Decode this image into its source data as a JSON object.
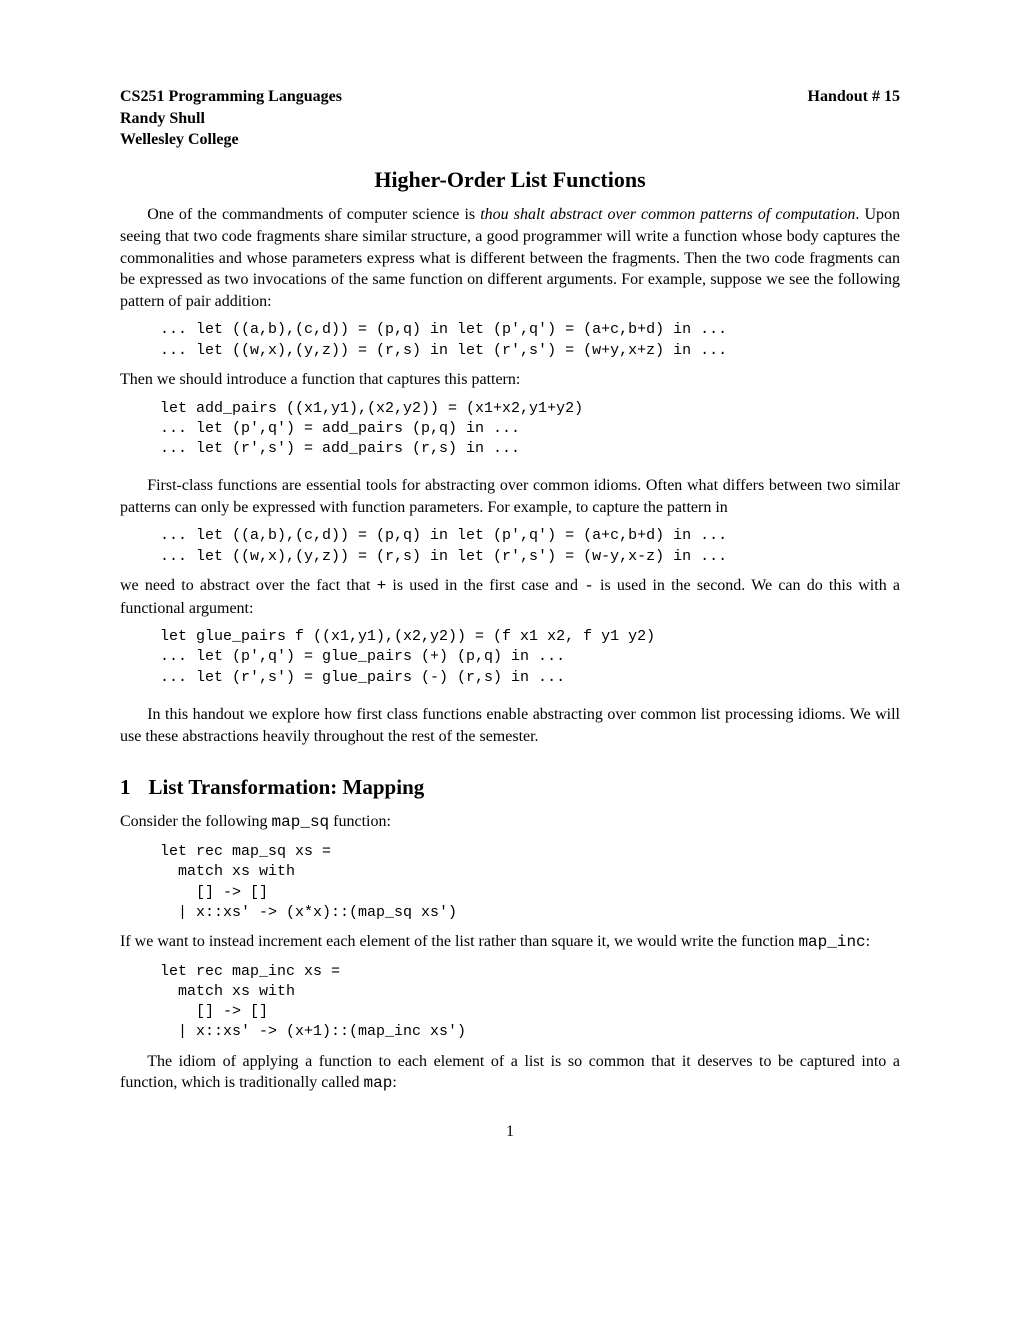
{
  "header": {
    "left_line1": "CS251 Programming Languages",
    "left_line2": "Randy Shull",
    "left_line3": "Wellesley College",
    "right": "Handout # 15"
  },
  "title": "Higher-Order List Functions",
  "para1_lead": "One of the commandments of computer science is ",
  "para1_ital": "thou shalt abstract over common patterns of computation",
  "para1_rest": ". Upon seeing that two code fragments share similar structure, a good programmer will write a function whose body captures the commonalities and whose parameters express what is different between the fragments. Then the two code fragments can be expressed as two invocations of the same function on different arguments. For example, suppose we see the following pattern of pair addition:",
  "code1": "... let ((a,b),(c,d)) = (p,q) in let (p',q') = (a+c,b+d) in ...\n... let ((w,x),(y,z)) = (r,s) in let (r',s') = (w+y,x+z) in ...",
  "para2": "Then we should introduce a function that captures this pattern:",
  "code2": "let add_pairs ((x1,y1),(x2,y2)) = (x1+x2,y1+y2)\n... let (p',q') = add_pairs (p,q) in ...\n... let (r',s') = add_pairs (r,s) in ...",
  "para3": "First-class functions are essential tools for abstracting over common idioms. Often what differs between two similar patterns can only be expressed with function parameters. For example, to capture the pattern in",
  "code3": "... let ((a,b),(c,d)) = (p,q) in let (p',q') = (a+c,b+d) in ...\n... let ((w,x),(y,z)) = (r,s) in let (r',s') = (w-y,x-z) in ...",
  "para4_a": "we need to abstract over the fact that ",
  "para4_plus": "+",
  "para4_b": " is used in the first case and ",
  "para4_minus": "-",
  "para4_c": " is used in the second. We can do this with a functional argument:",
  "code4": "let glue_pairs f ((x1,y1),(x2,y2)) = (f x1 x2, f y1 y2)\n... let (p',q') = glue_pairs (+) (p,q) in ...\n... let (r',s') = glue_pairs (-) (r,s) in ...",
  "para5": "In this handout we explore how first class functions enable abstracting over common list processing idioms. We will use these abstractions heavily throughout the rest of the semester.",
  "sec1_num": "1",
  "sec1_title": "List Transformation: Mapping",
  "para6_a": "Consider the following ",
  "para6_tt": "map_sq",
  "para6_b": " function:",
  "code5": "let rec map_sq xs =\n  match xs with\n    [] -> []\n  | x::xs' -> (x*x)::(map_sq xs')",
  "para7_a": "If we want to instead increment each element of the list rather than square it, we would write the function ",
  "para7_tt": "map_inc",
  "para7_b": ":",
  "code6": "let rec map_inc xs =\n  match xs with\n    [] -> []\n  | x::xs' -> (x+1)::(map_inc xs')",
  "para8_a": "The idiom of applying a function to each element of a list is so common that it deserves to be captured into a function, which is traditionally called ",
  "para8_tt": "map",
  "para8_b": ":",
  "pagenum": "1"
}
